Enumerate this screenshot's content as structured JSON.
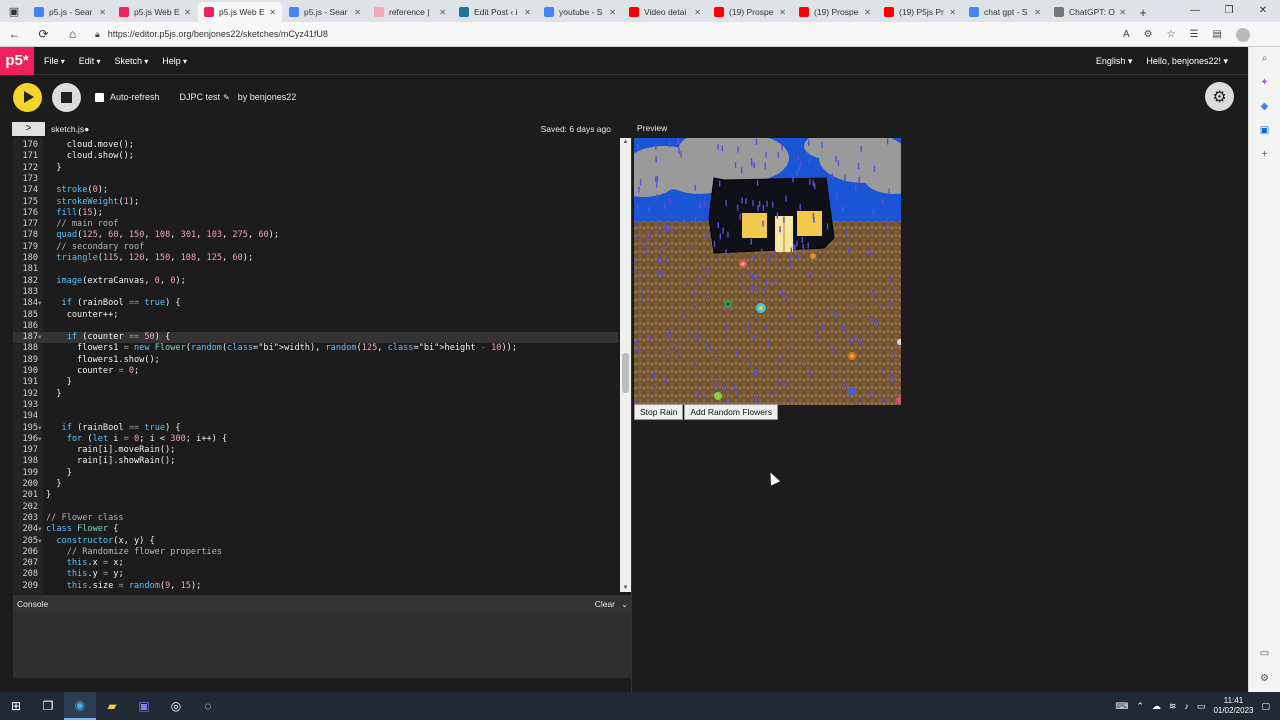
{
  "browser": {
    "tabs": [
      {
        "label": "p5.js - Sear",
        "color": "#4285f4",
        "active": false
      },
      {
        "label": "p5.js Web E",
        "color": "#ed225d",
        "active": false
      },
      {
        "label": "p5.js Web E",
        "color": "#ed225d",
        "active": true
      },
      {
        "label": "p5.js - Sear",
        "color": "#4285f4",
        "active": false
      },
      {
        "label": "reference |",
        "color": "#f4a6b8",
        "active": false
      },
      {
        "label": "Edit Post ‹ i",
        "color": "#21759b",
        "active": false
      },
      {
        "label": "youtube - S",
        "color": "#4285f4",
        "active": false
      },
      {
        "label": "Video detai",
        "color": "#ff0000",
        "active": false
      },
      {
        "label": "(19) Prospe",
        "color": "#ff0000",
        "active": false
      },
      {
        "label": "(19) Prospe",
        "color": "#ff0000",
        "active": false
      },
      {
        "label": "(19) P5js Pr",
        "color": "#ff0000",
        "active": false
      },
      {
        "label": "chat gpt - S",
        "color": "#4285f4",
        "active": false
      },
      {
        "label": "ChatGPT: O",
        "color": "#777777",
        "active": false
      }
    ],
    "url": "https://editor.p5js.org/benjones22/sketches/mCyz41fU8"
  },
  "p5": {
    "logo": "p5*",
    "menu": [
      "File",
      "Edit",
      "Sketch",
      "Help"
    ],
    "language": "English ▾",
    "user": "Hello, benjones22! ▾",
    "auto_refresh": "Auto-refresh",
    "sketch_name": "DJPC test",
    "by": "by benjones22",
    "filename": "sketch.js●",
    "saved": "Saved: 6 days ago",
    "preview_label": "Preview",
    "console_label": "Console",
    "clear_label": "Clear"
  },
  "code_lines": [
    {
      "n": "170",
      "fold": "",
      "html": "    cloud.move();"
    },
    {
      "n": "171",
      "fold": "",
      "html": "    cloud.show();"
    },
    {
      "n": "172",
      "fold": "",
      "html": "  }"
    },
    {
      "n": "173",
      "fold": "",
      "html": ""
    },
    {
      "n": "174",
      "fold": "",
      "html": "  stroke(0);"
    },
    {
      "n": "175",
      "fold": "",
      "html": "  strokeWeight(1);"
    },
    {
      "n": "176",
      "fold": "",
      "html": "  fill(15);"
    },
    {
      "n": "177",
      "fold": "",
      "html": "  // main roof"
    },
    {
      "n": "178",
      "fold": "",
      "html": "  quad(125, 60, 150, 108, 301, 103, 275, 60);"
    },
    {
      "n": "179",
      "fold": "",
      "html": "  // secondary roof"
    },
    {
      "n": "180",
      "fold": "",
      "html": "  triangle(115, 120, 150, 108, 125, 60);"
    },
    {
      "n": "181",
      "fold": "",
      "html": ""
    },
    {
      "n": "182",
      "fold": "",
      "html": "  image(extraCanvas, 0, 0);"
    },
    {
      "n": "183",
      "fold": "",
      "html": ""
    },
    {
      "n": "184",
      "fold": "▼",
      "html": "   if (rainBool == true) {"
    },
    {
      "n": "185",
      "fold": "",
      "html": "    counter++;"
    },
    {
      "n": "186",
      "fold": "",
      "html": ""
    },
    {
      "n": "187",
      "fold": "▼",
      "html": "    if (counter == 50) {"
    },
    {
      "n": "188",
      "fold": "",
      "html": "      flowers1 = new Flower(random(width), random(125, height - 10));"
    },
    {
      "n": "189",
      "fold": "",
      "html": "      flowers1.show();"
    },
    {
      "n": "190",
      "fold": "",
      "html": "      counter = 0;"
    },
    {
      "n": "191",
      "fold": "",
      "html": "    }"
    },
    {
      "n": "192",
      "fold": "",
      "html": "  }"
    },
    {
      "n": "193",
      "fold": "",
      "html": ""
    },
    {
      "n": "194",
      "fold": "",
      "html": ""
    },
    {
      "n": "195",
      "fold": "▼",
      "html": "   if (rainBool == true) {"
    },
    {
      "n": "196",
      "fold": "▼",
      "html": "    for (let i = 0; i < 300; i++) {"
    },
    {
      "n": "197",
      "fold": "",
      "html": "      rain[i].moveRain();"
    },
    {
      "n": "198",
      "fold": "",
      "html": "      rain[i].showRain();"
    },
    {
      "n": "199",
      "fold": "",
      "html": "    }"
    },
    {
      "n": "200",
      "fold": "",
      "html": "  }"
    },
    {
      "n": "201",
      "fold": "",
      "html": "}"
    },
    {
      "n": "202",
      "fold": "",
      "html": ""
    },
    {
      "n": "203",
      "fold": "",
      "html": "// Flower class"
    },
    {
      "n": "204",
      "fold": "▼",
      "html": "class Flower {"
    },
    {
      "n": "205",
      "fold": "▼",
      "html": "  constructor(x, y) {"
    },
    {
      "n": "206",
      "fold": "",
      "html": "    // Randomize flower properties"
    },
    {
      "n": "207",
      "fold": "",
      "html": "    this.x = x;"
    },
    {
      "n": "208",
      "fold": "",
      "html": "    this.y = y;"
    },
    {
      "n": "209",
      "fold": "",
      "html": "    this.size = random(9, 15);"
    }
  ],
  "preview_buttons": [
    "Stop Rain",
    "Add Random Flowers"
  ],
  "taskbar": {
    "time": "11:41",
    "date": "01/02/2023"
  },
  "colors": {
    "p5_pink": "#ed225d",
    "play_yellow": "#f5d52a",
    "sky_blue": "#1a55d6",
    "ground_brown": "#7a5a34"
  }
}
